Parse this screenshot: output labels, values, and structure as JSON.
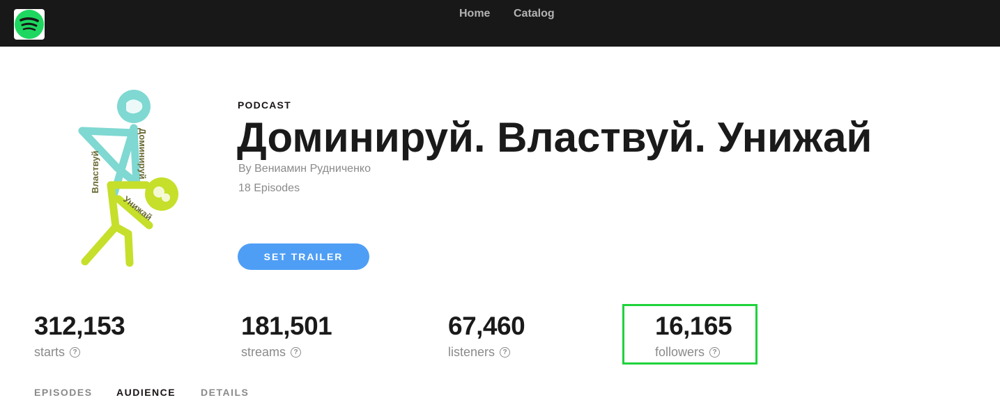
{
  "nav": {
    "home": "Home",
    "catalog": "Catalog"
  },
  "logo": {
    "icon": "spotify-logo-icon",
    "color": "#1ed760"
  },
  "podcast": {
    "label": "PODCAST",
    "title": "Доминируй. Властвуй. Унижай",
    "author": "By Вениамин Рудниченко",
    "episodes": "18 Episodes",
    "cover_words": [
      "Доминируй",
      "Властвуй",
      "Унижай"
    ]
  },
  "trailer_button": "SET TRAILER",
  "stats": [
    {
      "value": "312,153",
      "label": "starts"
    },
    {
      "value": "181,501",
      "label": "streams"
    },
    {
      "value": "67,460",
      "label": "listeners"
    },
    {
      "value": "16,165",
      "label": "followers"
    }
  ],
  "help_glyph": "?",
  "highlight_color": "#1ed33b",
  "accent_color": "#4f9ef5",
  "tabs": [
    {
      "label": "EPISODES",
      "active": false
    },
    {
      "label": "AUDIENCE",
      "active": true
    },
    {
      "label": "DETAILS",
      "active": false
    }
  ]
}
